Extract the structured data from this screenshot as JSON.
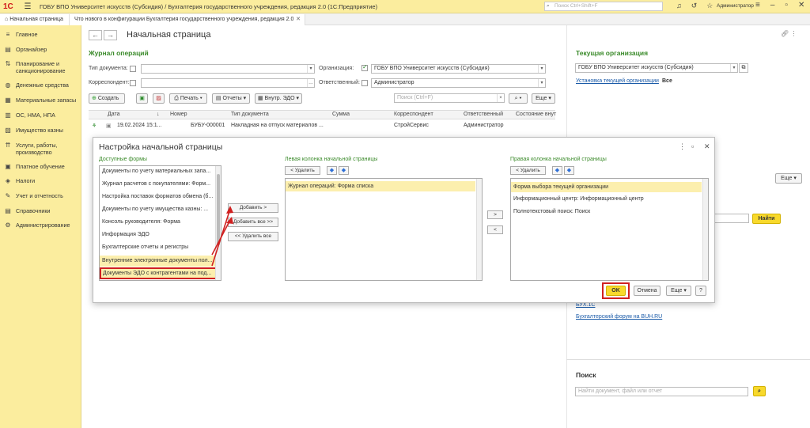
{
  "titlebar": {
    "logo": "1С",
    "title": "ГОБУ ВПО Университет искусств (Субсидия) / Бухгалтерия государственного учреждения, редакция 2.0  (1С:Предприятие)",
    "search_placeholder": "Поиск Ctrl+Shift+F",
    "user": "Администратор"
  },
  "tabs": [
    {
      "label": "Начальная страница"
    },
    {
      "label": "Что нового в конфигурации Бухгалтерия государственного учреждения, редакция 2.0"
    }
  ],
  "sidebar": {
    "items": [
      {
        "label": "Главное",
        "icon": "≡"
      },
      {
        "label": "Органайзер",
        "icon": "▤"
      },
      {
        "label": "Планирование и санкционирование",
        "icon": "⇅"
      },
      {
        "label": "Денежные средства",
        "icon": "◍"
      },
      {
        "label": "Материальные запасы",
        "icon": "▦"
      },
      {
        "label": "ОС, НМА, НПА",
        "icon": "▥"
      },
      {
        "label": "Имущество казны",
        "icon": "▨"
      },
      {
        "label": "Услуги, работы, производство",
        "icon": "⇈"
      },
      {
        "label": "Платное обучение",
        "icon": "▣"
      },
      {
        "label": "Налоги",
        "icon": "◈"
      },
      {
        "label": "Учет и отчетность",
        "icon": "✎"
      },
      {
        "label": "Справочники",
        "icon": "▤"
      },
      {
        "label": "Администрирование",
        "icon": "⚙"
      }
    ]
  },
  "main": {
    "page_title": "Начальная страница",
    "journal": {
      "title": "Журнал операций",
      "doc_type_label": "Тип документа:",
      "org_label": "Организация:",
      "org_value": "ГОБУ ВПО Университет искусств (Субсидия)",
      "corr_label": "Корреспондент:",
      "resp_label": "Ответственный:",
      "resp_value": "Администратор",
      "toolbar": {
        "create": "Создать",
        "print": "Печать",
        "reports": "Отчеты",
        "edo": "Внутр. ЭДО",
        "search_placeholder": "Поиск (Ctrl+F)",
        "more": "Еще"
      },
      "columns": [
        "Дата",
        "Номер",
        "Тип документа",
        "Сумма",
        "Корреспондент",
        "Ответственный",
        "Состояние внут"
      ],
      "rows": [
        {
          "date": "19.02.2024 15:1...",
          "number": "БУБУ-000001",
          "type": "Накладная на отпуск материалов ...",
          "sum": "",
          "corr": "СтройСервис",
          "resp": "Администратор",
          "state": ""
        }
      ]
    }
  },
  "right_panel": {
    "org_title": "Текущая организация",
    "org_value": "ГОБУ ВПО Университет искусств (Субсидия)",
    "org_link": "Установка текущей организации",
    "org_link_all": "Все",
    "more_btn": "Еще",
    "find_btn": "Найти",
    "links": [
      "БУХ.1С",
      "Бухгалтерский форум на BUH.RU"
    ],
    "search_title": "Поиск",
    "search_placeholder": "Найти документ, файл или отчет"
  },
  "dialog": {
    "title": "Настройка начальной страницы",
    "available_title": "Доступные формы",
    "available_items": [
      "Документы по учету материальных запа...",
      "Журнал расчетов с покупателями: Форм...",
      "Настройка поставок форматов обмена (б...",
      "Документы по учету имущества казны: ...",
      "Консоль руководителя: Форма",
      "Информация ЭДО",
      "Бухгалтерские отчеты и регистры",
      "Внутренние электронные документы пол...",
      "Документы ЭДО с контрагентами на под..."
    ],
    "add_btn": "Добавить >",
    "add_all_btn": "Добавить все >>",
    "remove_all_btn": "<< Удалить все",
    "left_title": "Левая колонка начальной страницы",
    "left_delete": "< Удалить",
    "left_items": [
      "Журнал операций: Форма списка"
    ],
    "move_right": ">",
    "move_left": "<",
    "right_title": "Правая колонка начальной страницы",
    "right_delete": "< Удалить",
    "right_items": [
      "Форма выбора текущей организации",
      "Информационный центр: Информационный центр",
      "Полнотекстовый поиск: Поиск"
    ],
    "ok": "OK",
    "cancel": "Отмена",
    "more": "Еще",
    "help": "?"
  }
}
